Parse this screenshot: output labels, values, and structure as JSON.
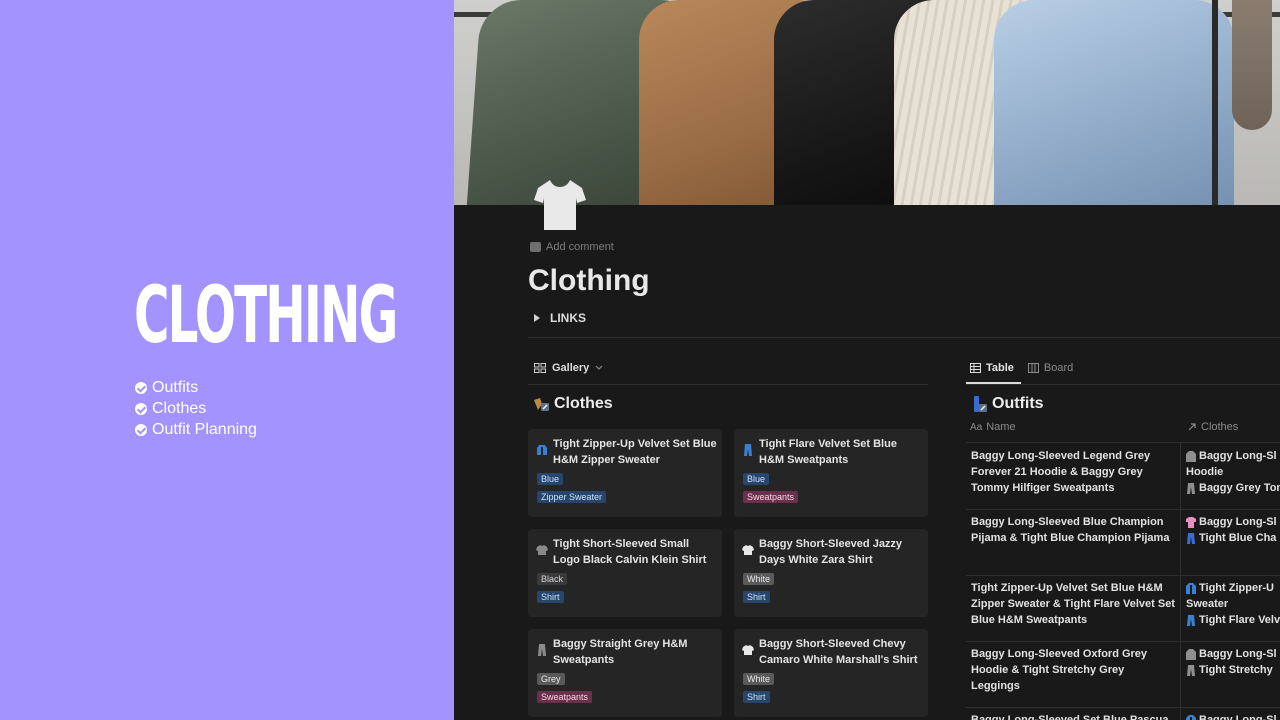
{
  "promo": {
    "title": "CLOTHING",
    "items": [
      "Outfits",
      "Clothes",
      "Outfit Planning"
    ]
  },
  "page": {
    "add_comment": "Add comment",
    "title": "Clothing",
    "toggle_label": "LINKS"
  },
  "gallery": {
    "view_label": "Gallery",
    "db_title": "Clothes",
    "cards": [
      {
        "title": "Tight Zipper-Up Velvet Set Blue H&M Zipper Sweater",
        "tags": [
          "Blue",
          "Zipper Sweater"
        ],
        "icon": "jacket-icon"
      },
      {
        "title": "Tight Flare Velvet Set Blue H&M Sweatpants",
        "tags": [
          "Blue",
          "Sweatpants"
        ],
        "icon": "pants-icon"
      },
      {
        "title": "Tight Short-Sleeved Small Logo Black Calvin Klein Shirt",
        "tags": [
          "Black",
          "Shirt"
        ],
        "icon": "shirt-icon"
      },
      {
        "title": "Baggy Short-Sleeved Jazzy Days White Zara Shirt",
        "tags": [
          "White",
          "Shirt"
        ],
        "icon": "shirt-icon"
      },
      {
        "title": "Baggy Straight Grey H&M Sweatpants",
        "tags": [
          "Grey",
          "Sweatpants"
        ],
        "icon": "pants-icon"
      },
      {
        "title": "Baggy Short-Sleeved Chevy Camaro White Marshall's Shirt",
        "tags": [
          "White",
          "Shirt"
        ],
        "icon": "shirt-icon"
      }
    ]
  },
  "table": {
    "tabs": [
      "Table",
      "Board"
    ],
    "db_title": "Outfits",
    "col_name": "Name",
    "col_name_prefix": "Aa",
    "col_rel": "Clothes",
    "rows": [
      {
        "name": "Baggy Long-Sleeved Legend Grey Forever 21 Hoodie & Baggy Grey Tommy Hilfiger Sweatpants",
        "rel": [
          "Baggy Long-Sl",
          "Hoodie",
          "Baggy Grey Tom"
        ]
      },
      {
        "name": "Baggy Long-Sleeved Blue Champion Pijama & Tight Blue Champion Pijama",
        "rel": [
          "Baggy Long-Sl",
          "Tight Blue Cha"
        ]
      },
      {
        "name": "Tight Zipper-Up Velvet Set Blue H&M Zipper Sweater & Tight Flare Velvet Set Blue H&M Sweatpants",
        "rel": [
          "Tight Zipper-U",
          "Sweater",
          "Tight Flare Velv"
        ]
      },
      {
        "name": "Baggy Long-Sleeved Oxford Grey Hoodie & Tight Stretchy Grey Leggings",
        "rel": [
          "Baggy Long-Sl",
          "Tight Stretchy"
        ]
      },
      {
        "name": "Baggy Long-Sleeved Set Blue Pascua",
        "rel": [
          "Baggy Long-Sl"
        ]
      }
    ]
  },
  "colors": {
    "promo_bg": "#a393ff",
    "tag_blue": "#28456c",
    "tag_pink": "#69314c",
    "tag_gray": "#5a5a5a"
  }
}
